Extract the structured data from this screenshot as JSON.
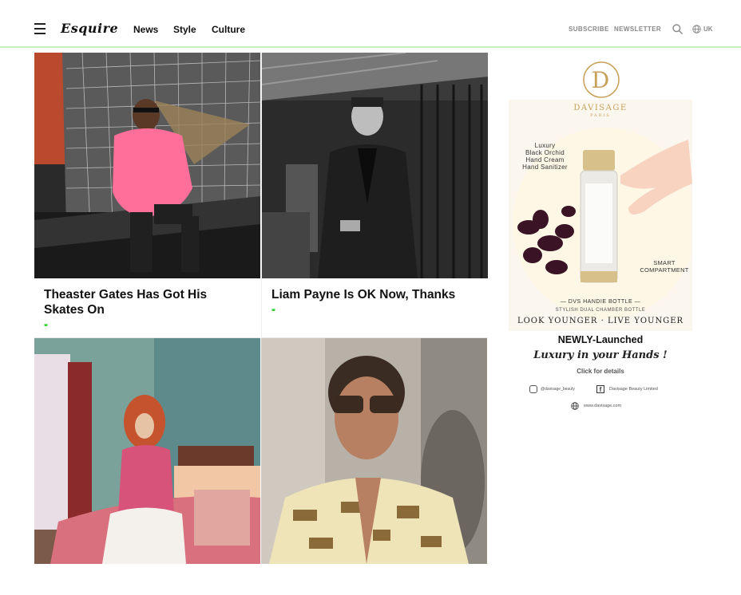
{
  "header": {
    "logo": "Esquire",
    "nav": [
      "News",
      "Style",
      "Culture"
    ],
    "subscribe": "SUBSCRIBE",
    "newsletter": "NEWSLETTER",
    "region": "UK"
  },
  "articles": [
    {
      "title": "Theaster Gates Has Got His Skates On",
      "dots": "••"
    },
    {
      "title": "Liam Payne Is OK Now, Thanks",
      "dots": "••"
    },
    {
      "title": "",
      "dots": ""
    },
    {
      "title": "",
      "dots": ""
    }
  ],
  "ad": {
    "brand_initial": "D",
    "brand": "DAVISAGE",
    "brand_sub": "PARIS",
    "product_lines": [
      "Luxury",
      "Black Orchid",
      "Hand Cream",
      "Hand Sanitizer"
    ],
    "feature": "SMART\nCOMPARTMENT",
    "bottle_name": "— DVS HANDIE BOTTLE —",
    "bottle_desc": "STYLISH DUAL CHAMBER BOTTLE",
    "slogan": "LOOK YOUNGER · LIVE YOUNGER",
    "launch": "NEWLY-Launched",
    "script": "Luxury in your Hands !",
    "cta": "Click for details",
    "instagram": "@davisage_beauty",
    "facebook": "Davisage Beauty Limited",
    "website": "www.davisage.com"
  },
  "colors": {
    "accent_green": "#3bd63b",
    "divider": "#c9efc0",
    "muted": "#888888"
  }
}
